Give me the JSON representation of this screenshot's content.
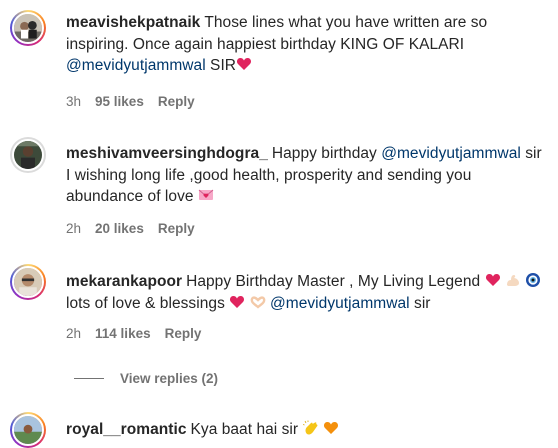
{
  "comments": [
    {
      "username": "meavishekpatnaik",
      "text": "Those lines what you have written are so inspiring. Once again happiest birthday KING OF KALARI ",
      "mention": "@mevidyutjammwal",
      "tail": " SIR",
      "time": "3h",
      "likes": "95 likes",
      "reply": "Reply"
    },
    {
      "username": "meshivamveersinghdogra_",
      "text": "Happy birthday ",
      "mention": "@mevidyutjammwal",
      "tail": " sir I wishing long life ,good health, prosperity and sending you abundance of love ",
      "time": "2h",
      "likes": "20 likes",
      "reply": "Reply"
    },
    {
      "username": "mekarankapoor",
      "text": "Happy Birthday Master , My Living Legend ",
      "mid": " lots of love & blessings ",
      "mention": "@mevidyutjammwal",
      "tail": " sir",
      "time": "2h",
      "likes": "114 likes",
      "reply": "Reply"
    },
    {
      "username": "royal__romantic",
      "text": "Kya baat hai sir "
    }
  ],
  "view_replies": "View replies (2)",
  "icons": {
    "heart": "red-heart-emoji",
    "love_letter": "heart-letter-emoji",
    "muscle": "flexed-biceps-emoji",
    "evil_eye": "nazar-amulet-emoji",
    "heart_hands": "heart-hands-emoji",
    "clap": "clapping-hands-emoji",
    "orange_heart": "orange-heart-emoji"
  },
  "colors": {
    "text": "#262626",
    "meta": "#737373",
    "mention": "#00376b",
    "heart": "#e0245e"
  }
}
